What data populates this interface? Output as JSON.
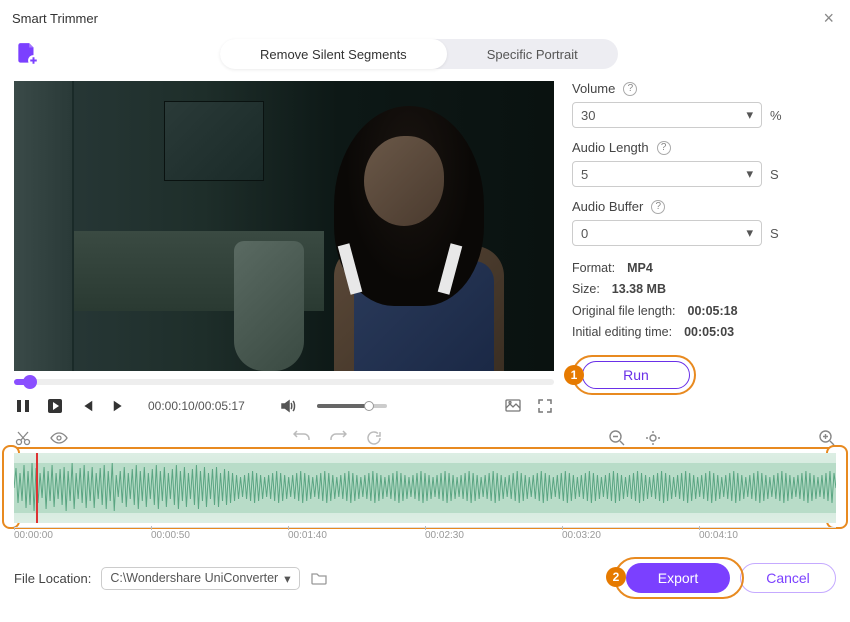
{
  "window": {
    "title": "Smart Trimmer"
  },
  "tabs": {
    "active": "Remove Silent Segments",
    "inactive": "Specific Portrait"
  },
  "player": {
    "time_current": "00:00:10",
    "time_total": "00:05:17",
    "time_display": "00:00:10/00:05:17"
  },
  "settings": {
    "volume": {
      "label": "Volume",
      "value": "30",
      "unit": "%"
    },
    "audio_length": {
      "label": "Audio Length",
      "value": "5",
      "unit": "S"
    },
    "audio_buffer": {
      "label": "Audio Buffer",
      "value": "0",
      "unit": "S"
    }
  },
  "info": {
    "format_label": "Format:",
    "format": "MP4",
    "size_label": "Size:",
    "size": "13.38 MB",
    "orig_len_label": "Original file length:",
    "orig_len": "00:05:18",
    "init_time_label": "Initial editing time:",
    "init_time": "00:05:03"
  },
  "run": {
    "label": "Run",
    "badge": "1"
  },
  "timeline": {
    "marks": [
      "00:00:00",
      "00:00:50",
      "00:01:40",
      "00:02:30",
      "00:03:20",
      "00:04:10"
    ]
  },
  "footer": {
    "location_label": "File Location:",
    "path": "C:\\Wondershare UniConverter",
    "export": "Export",
    "cancel": "Cancel",
    "export_badge": "2"
  }
}
